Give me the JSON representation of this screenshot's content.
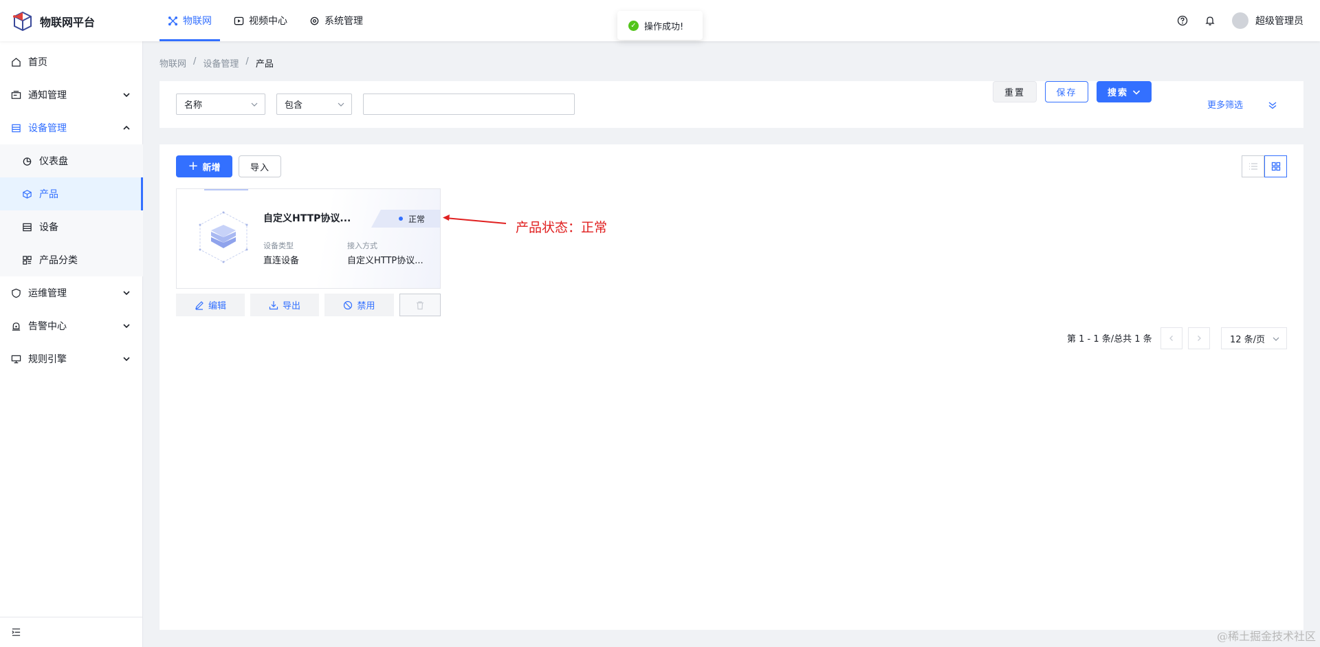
{
  "app": {
    "title": "物联网平台"
  },
  "topnav": [
    {
      "label": "物联网",
      "icon": "iot-icon",
      "active": true
    },
    {
      "label": "视频中心",
      "icon": "video-icon",
      "active": false
    },
    {
      "label": "系统管理",
      "icon": "system-icon",
      "active": false
    }
  ],
  "user": {
    "name": "超级管理员"
  },
  "toast": {
    "text": "操作成功!"
  },
  "sidebar": {
    "home": "首页",
    "notify": "通知管理",
    "device_mgmt": "设备管理",
    "dashboard": "仪表盘",
    "product": "产品",
    "device": "设备",
    "category": "产品分类",
    "ops": "运维管理",
    "alarm": "告警中心",
    "rules": "规则引擎"
  },
  "breadcrumb": {
    "a": "物联网",
    "sep": "/",
    "b": "设备管理",
    "c": "产品"
  },
  "filter": {
    "field_value": "名称",
    "operator_value": "包含",
    "keyword_value": "",
    "reset": "重置",
    "save": "保存",
    "search": "搜索",
    "more": "更多筛选"
  },
  "toolbar": {
    "new": "新增",
    "import": "导入"
  },
  "card": {
    "name": "自定义HTTP协议...",
    "status": "正常",
    "type_label": "设备类型",
    "type_value": "直连设备",
    "access_label": "接入方式",
    "access_value": "自定义HTTP协议..."
  },
  "card_actions": {
    "edit": "编辑",
    "export": "导出",
    "disable": "禁用"
  },
  "pagination": {
    "total": "第 1 - 1 条/总共 1 条",
    "page_size": "12 条/页"
  },
  "annotation": {
    "text": "产品状态：正常"
  },
  "watermark": "@稀土掘金技术社区",
  "colors": {
    "primary": "#3370ff",
    "success": "#52c41a",
    "annotation": "#e02020"
  }
}
